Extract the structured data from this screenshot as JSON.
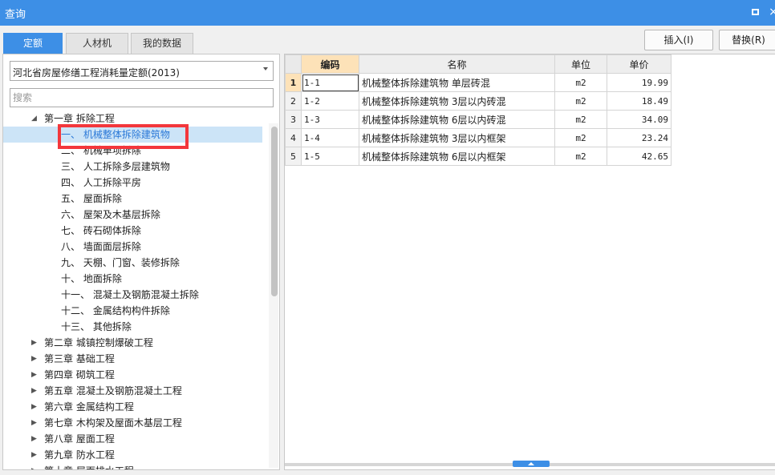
{
  "window": {
    "title": "查询",
    "restore_label": "",
    "close_label": "×"
  },
  "tabs": [
    {
      "label": "定额",
      "active": true
    },
    {
      "label": "人材机",
      "active": false
    },
    {
      "label": "我的数据",
      "active": false
    }
  ],
  "toolbar": {
    "insert_label": "插入(I)",
    "replace_label": "替换(R)"
  },
  "left": {
    "quota_select_value": "河北省房屋修缮工程消耗量定额(2013)",
    "search_placeholder": "搜索",
    "tree": [
      {
        "label": "第一章 拆除工程",
        "level": 0,
        "expanded": true
      },
      {
        "label": "一、 机械整体拆除建筑物",
        "level": 1,
        "selected": true
      },
      {
        "label": "二、 机械单项拆除",
        "level": 1
      },
      {
        "label": "三、 人工拆除多层建筑物",
        "level": 1
      },
      {
        "label": "四、 人工拆除平房",
        "level": 1
      },
      {
        "label": "五、 屋面拆除",
        "level": 1
      },
      {
        "label": "六、 屋架及木基层拆除",
        "level": 1
      },
      {
        "label": "七、 砖石砌体拆除",
        "level": 1
      },
      {
        "label": "八、 墙面面层拆除",
        "level": 1
      },
      {
        "label": "九、 天棚、门窗、装修拆除",
        "level": 1
      },
      {
        "label": "十、 地面拆除",
        "level": 1
      },
      {
        "label": "十一、 混凝土及钢筋混凝土拆除",
        "level": 1
      },
      {
        "label": "十二、 金属结构构件拆除",
        "level": 1
      },
      {
        "label": "十三、 其他拆除",
        "level": 1
      },
      {
        "label": "第二章 城镇控制爆破工程",
        "level": 0
      },
      {
        "label": "第三章 基础工程",
        "level": 0
      },
      {
        "label": "第四章 砌筑工程",
        "level": 0
      },
      {
        "label": "第五章 混凝土及钢筋混凝土工程",
        "level": 0
      },
      {
        "label": "第六章 金属结构工程",
        "level": 0
      },
      {
        "label": "第七章 木构架及屋面木基层工程",
        "level": 0
      },
      {
        "label": "第八章 屋面工程",
        "level": 0
      },
      {
        "label": "第九章 防水工程",
        "level": 0
      },
      {
        "label": "第十章 屋面排水工程",
        "level": 0
      }
    ]
  },
  "grid": {
    "headers": [
      "",
      "编码",
      "名称",
      "单位",
      "单价"
    ],
    "rows": [
      {
        "num": "1",
        "code": "1-1",
        "name": "机械整体拆除建筑物 单层砖混",
        "unit": "m2",
        "price": "19.99"
      },
      {
        "num": "2",
        "code": "1-2",
        "name": "机械整体拆除建筑物 3层以内砖混",
        "unit": "m2",
        "price": "18.49"
      },
      {
        "num": "3",
        "code": "1-3",
        "name": "机械整体拆除建筑物 6层以内砖混",
        "unit": "m2",
        "price": "34.09"
      },
      {
        "num": "4",
        "code": "1-4",
        "name": "机械整体拆除建筑物 3层以内框架",
        "unit": "m2",
        "price": "23.24"
      },
      {
        "num": "5",
        "code": "1-5",
        "name": "机械整体拆除建筑物 6层以内框架",
        "unit": "m2",
        "price": "42.65"
      }
    ]
  },
  "colors": {
    "accent": "#3d8fe6",
    "highlight": "#f3373c",
    "selected_row": "#cce4f7",
    "sorted_header": "#fde2b8"
  }
}
